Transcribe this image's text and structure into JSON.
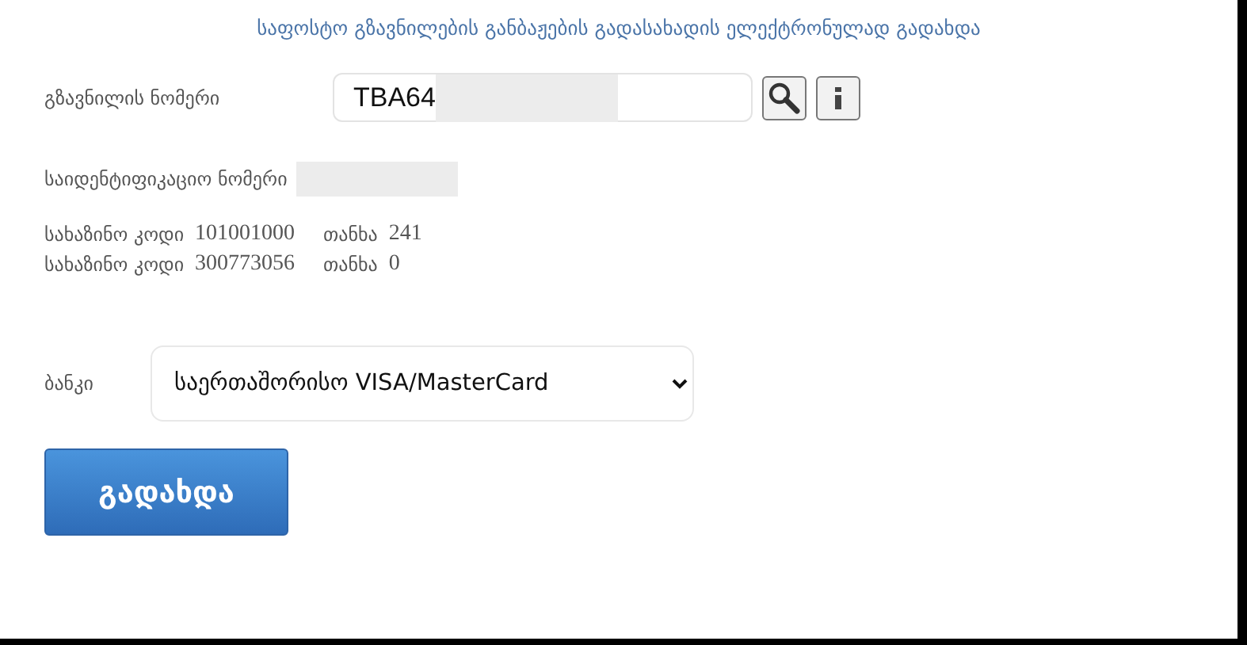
{
  "title": "საფოსტო გზავნილების განბაჟების გადასახადის ელექტრონულად გადახდა",
  "parcel": {
    "label": "გზავნილის ნომერი",
    "value": "TBA64",
    "redacted": true
  },
  "identification": {
    "label": "საიდენტიფიკაციო ნომერი",
    "redacted": true
  },
  "payments": [
    {
      "code_label": "სახაზინო კოდი",
      "code": "101001000",
      "amount_label": "თანხა",
      "amount": "241"
    },
    {
      "code_label": "სახაზინო კოდი",
      "code": "300773056",
      "amount_label": "თანხა",
      "amount": "0"
    }
  ],
  "bank": {
    "label": "ბანკი",
    "value": "საერთაშორისო VISA/MasterCard"
  },
  "pay_button": "გადახდა"
}
